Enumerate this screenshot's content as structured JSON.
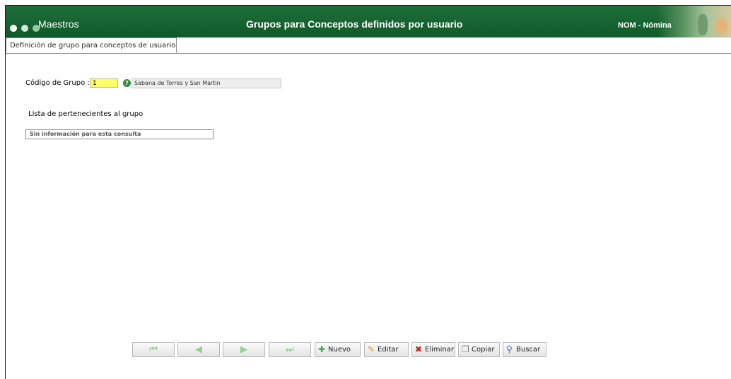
{
  "header": {
    "app_name": "Maestros",
    "title": "Grupos para Conceptos definidos por usuario",
    "module": "NOM - Nómina",
    "dots_colors": [
      "#ffffff",
      "#d8e8d8",
      "#9cc49c"
    ]
  },
  "tabs": [
    {
      "label": "Definición de grupo para conceptos de usuario",
      "active": true
    }
  ],
  "form": {
    "code_label": "Código de Grupo :",
    "code_value": "1",
    "group_name": "Sabana de Torres y San Martin",
    "members_label": "Lista de pertenecientes al grupo",
    "members_empty": "Sin información para esta consulta"
  },
  "toolbar": {
    "new": "Nuevo",
    "edit": "Editar",
    "delete": "Eliminar",
    "copy": "Copiar",
    "search": "Buscar"
  },
  "colors": {
    "header_bg": "#0f5a2a",
    "code_input_bg": "#ffff66",
    "nav_arrow": "#8fd48a"
  }
}
